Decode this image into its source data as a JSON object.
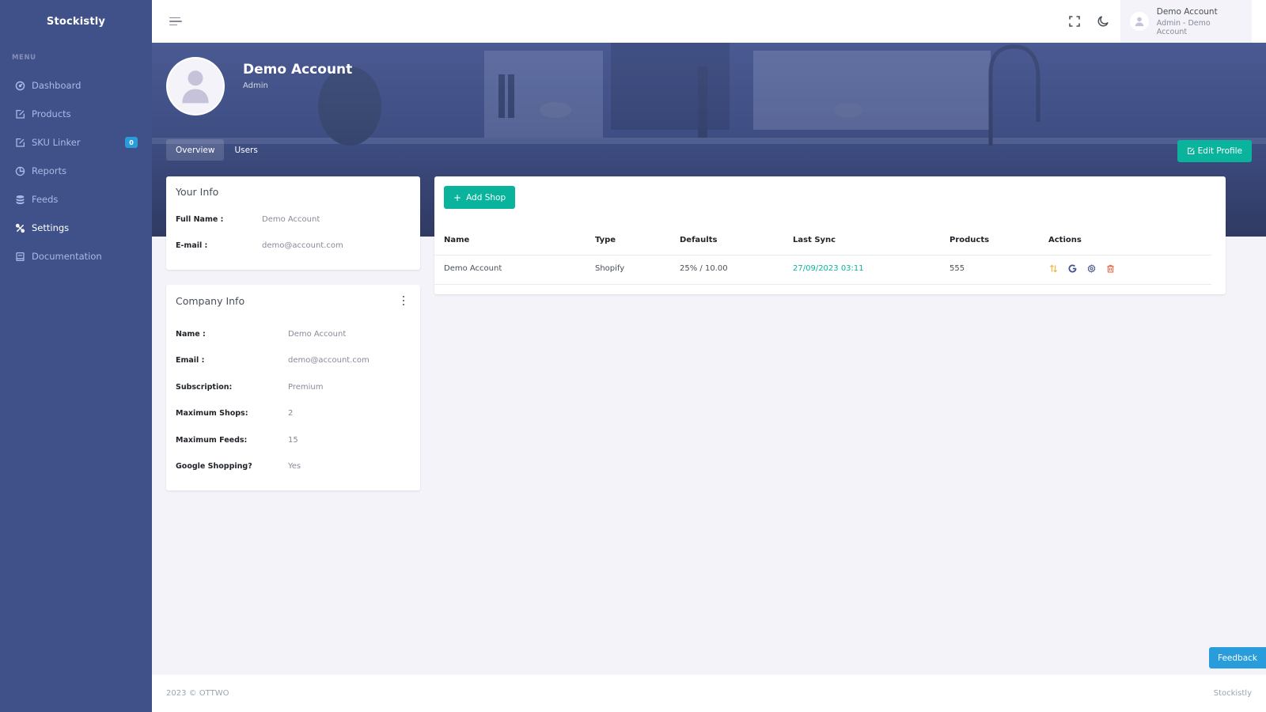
{
  "app": {
    "brand": "Stockistly"
  },
  "sidebar": {
    "menu_title": "MENU",
    "items": [
      {
        "label": "Dashboard",
        "icon": "dashboard-gauge-icon"
      },
      {
        "label": "Products",
        "icon": "edit-box-icon"
      },
      {
        "label": "SKU Linker",
        "icon": "edit-box-icon",
        "badge": "0"
      },
      {
        "label": "Reports",
        "icon": "pie-chart-icon"
      },
      {
        "label": "Feeds",
        "icon": "database-icon"
      },
      {
        "label": "Settings",
        "icon": "tools-icon",
        "active": true
      },
      {
        "label": "Documentation",
        "icon": "book-icon"
      }
    ]
  },
  "topbar": {
    "menu_toggle_icon": "hamburger-icon",
    "fullscreen_icon": "fullscreen-icon",
    "theme_icon": "moon-icon",
    "user": {
      "name": "Demo Account",
      "role": "Admin - Demo Account"
    }
  },
  "profile": {
    "name": "Demo Account",
    "role": "Admin",
    "tabs": [
      {
        "label": "Overview",
        "active": true
      },
      {
        "label": "Users",
        "active": false
      }
    ],
    "edit_button": "Edit Profile"
  },
  "your_info": {
    "title": "Your Info",
    "rows": [
      {
        "label": "Full Name :",
        "value": "Demo Account"
      },
      {
        "label": "E-mail :",
        "value": "demo@account.com"
      }
    ]
  },
  "company_info": {
    "title": "Company Info",
    "rows": [
      {
        "label": "Name :",
        "value": "Demo Account"
      },
      {
        "label": "Email :",
        "value": "demo@account.com"
      },
      {
        "label": "Subscription:",
        "value": "Premium"
      },
      {
        "label": "Maximum Shops:",
        "value": "2"
      },
      {
        "label": "Maximum Feeds:",
        "value": "15"
      },
      {
        "label": "Google Shopping?",
        "value": "Yes"
      }
    ]
  },
  "shops": {
    "add_button": "Add Shop",
    "columns": [
      "Name",
      "Type",
      "Defaults",
      "Last Sync",
      "Products",
      "Actions"
    ],
    "rows": [
      {
        "name": "Demo Account",
        "type": "Shopify",
        "defaults": "25% / 10.00",
        "last_sync": "27/09/2023 03:11",
        "products": "555",
        "actions": [
          "sync-arrows-icon",
          "google-icon",
          "settings-gear-icon",
          "delete-trash-icon"
        ]
      }
    ]
  },
  "colors": {
    "sidebar": "#405189",
    "accent": "#0ab39c",
    "info": "#299cdb",
    "warning": "#f7b84b",
    "danger": "#f06548"
  },
  "feedback_button": "Feedback",
  "footer": {
    "left": "2023 © OTTWO",
    "right": "Stockistly"
  }
}
